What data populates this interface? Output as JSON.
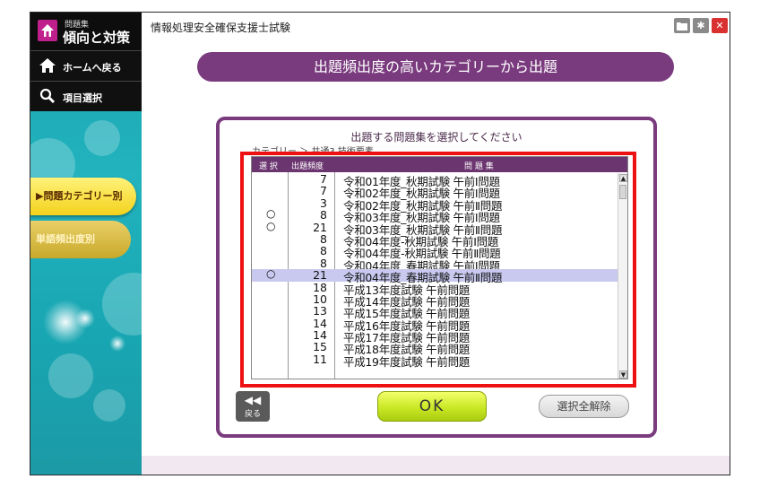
{
  "app": {
    "logo_sub": "問題集",
    "logo_title": "傾向と対策",
    "window_title": "情報処理安全確保支援士試験"
  },
  "sidebar": {
    "home_label": "ホームへ戻る",
    "items_label": "項目選択",
    "category_button": "▶問題カテゴリー別",
    "word_button": "単語頻出度別"
  },
  "banner": {
    "title": "出題頻出度の高いカテゴリーから出題"
  },
  "dialog": {
    "title": "出題する問題集を選択してください",
    "breadcrumb": "カテゴリー ＞ 共通3 技術要素",
    "columns": {
      "select": "選 択",
      "freq": "出題頻度",
      "set": "問 題 集"
    },
    "rows": [
      {
        "mark": "",
        "freq": "7",
        "name": "令和01年度_秋期試験 午前Ⅰ問題",
        "selected_row": false
      },
      {
        "mark": "",
        "freq": "7",
        "name": "令和02年度_秋期試験 午前Ⅰ問題",
        "selected_row": false
      },
      {
        "mark": "",
        "freq": "3",
        "name": "令和02年度_秋期試験 午前Ⅱ問題",
        "selected_row": false
      },
      {
        "mark": "○",
        "freq": "8",
        "name": "令和03年度_秋期試験 午前Ⅰ問題",
        "selected_row": false
      },
      {
        "mark": "○",
        "freq": "21",
        "name": "令和03年度_秋期試験 午前Ⅱ問題",
        "selected_row": false
      },
      {
        "mark": "",
        "freq": "8",
        "name": "令和04年度-秋期試験 午前Ⅰ問題",
        "selected_row": false
      },
      {
        "mark": "",
        "freq": "8",
        "name": "令和04年度-秋期試験 午前Ⅱ問題",
        "selected_row": false
      },
      {
        "mark": "",
        "freq": "8",
        "name": "令和04年度_春期試験 午前Ⅰ問題",
        "selected_row": false
      },
      {
        "mark": "○",
        "freq": "21",
        "name": "令和04年度_春期試験 午前Ⅱ問題",
        "selected_row": true
      },
      {
        "mark": "",
        "freq": "18",
        "name": "平成13年度試験 午前問題",
        "selected_row": false
      },
      {
        "mark": "",
        "freq": "10",
        "name": "平成14年度試験 午前問題",
        "selected_row": false
      },
      {
        "mark": "",
        "freq": "13",
        "name": "平成15年度試験 午前問題",
        "selected_row": false
      },
      {
        "mark": "",
        "freq": "14",
        "name": "平成16年度試験 午前問題",
        "selected_row": false
      },
      {
        "mark": "",
        "freq": "14",
        "name": "平成17年度試験 午前問題",
        "selected_row": false
      },
      {
        "mark": "",
        "freq": "15",
        "name": "平成18年度試験 午前問題",
        "selected_row": false
      },
      {
        "mark": "",
        "freq": "11",
        "name": "平成19年度試験 午前問題",
        "selected_row": false
      }
    ],
    "back_label": "戻る",
    "ok_label": "OK",
    "clear_label": "選択全解除"
  },
  "colors": {
    "accent_purple": "#7a3b7e",
    "highlight_red": "#ee1111",
    "selected_row": "#c9c9f0",
    "ok_green": "#c9e825"
  }
}
